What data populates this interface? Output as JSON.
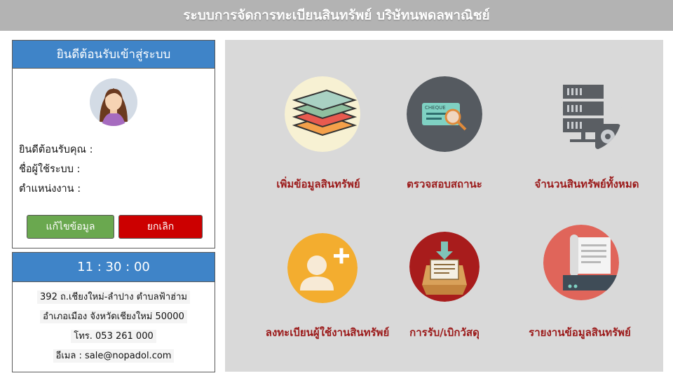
{
  "header": {
    "title": "ระบบการจัดการทะเบียนสินทรัพย์ บริษัทนพดลพาณิชย์"
  },
  "welcome": {
    "title": "ยินดีต้อนรับเข้าสู่ระบบ",
    "greeting_label": "ยินดีต้อนรับคุณ :",
    "username_label": "ชื่อผู้ใช้ระบบ :",
    "position_label": "ตำแหน่งงาน :",
    "edit_button": "แก้ไขข้อมูล",
    "cancel_button": "ยกเลิก"
  },
  "clock": {
    "time": "11 : 30 : 00",
    "address_line1": "392 ถ.เชียงใหม่-ลำปาง ตำบลฟ้าฮ่าม",
    "address_line2": "อำเภอเมือง จังหวัดเชียงใหม่ 50000",
    "phone": "โทร. 053 261 000",
    "email": "อีเมล : sale@nopadol.com"
  },
  "menu": {
    "add_asset": "เพิ่มข้อมูลสินทรัพย์",
    "check_status": "ตรวจสอบสถานะ",
    "total_assets": "จำนวนสินทรัพย์ทั้งหมด",
    "register_user": "ลงทะเบียนผู้ใช้งานสินทรัพย์",
    "receive_withdraw": "การรับ/เบิกวัสดุ",
    "report": "รายงานข้อมูลสินทรัพย์"
  },
  "colors": {
    "header_bg": "#b3b3b3",
    "panel_head": "#3f84c8",
    "menu_label": "#9b1a1a",
    "edit_button": "#6aa84f",
    "cancel_button": "#cc0000"
  }
}
